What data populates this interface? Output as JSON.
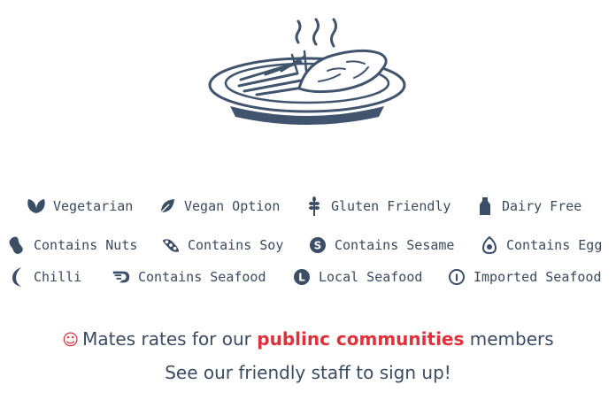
{
  "colors": {
    "ink": "#3c4e66",
    "brand": "#e0303a"
  },
  "illustration": {
    "icon": "plate-of-fish-and-chips-icon"
  },
  "legend": [
    {
      "icon": "leaves-icon",
      "label": "Vegetarian"
    },
    {
      "icon": "leaf-icon",
      "label": "Vegan Option"
    },
    {
      "icon": "wheat-icon",
      "label": "Gluten Friendly"
    },
    {
      "icon": "bottle-icon",
      "label": "Dairy Free"
    },
    {
      "icon": "peanut-icon",
      "label": "Contains Nuts"
    },
    {
      "icon": "soybean-icon",
      "label": "Contains Soy"
    },
    {
      "icon": "sesame-s-icon",
      "label": "Contains Sesame"
    },
    {
      "icon": "egg-icon",
      "label": "Contains Egg"
    },
    {
      "icon": "chilli-icon",
      "label": "Chilli"
    },
    {
      "icon": "shrimp-icon",
      "label": "Contains Seafood"
    },
    {
      "icon": "local-l-icon",
      "label": "Local Seafood"
    },
    {
      "icon": "imported-i-icon",
      "label": "Imported Seafood"
    }
  ],
  "promo": {
    "smiley": "☺",
    "line1_before": "Mates rates for our",
    "brand": "publinc communities",
    "line1_after": "members",
    "line2": "See our friendly staff to sign up!"
  }
}
